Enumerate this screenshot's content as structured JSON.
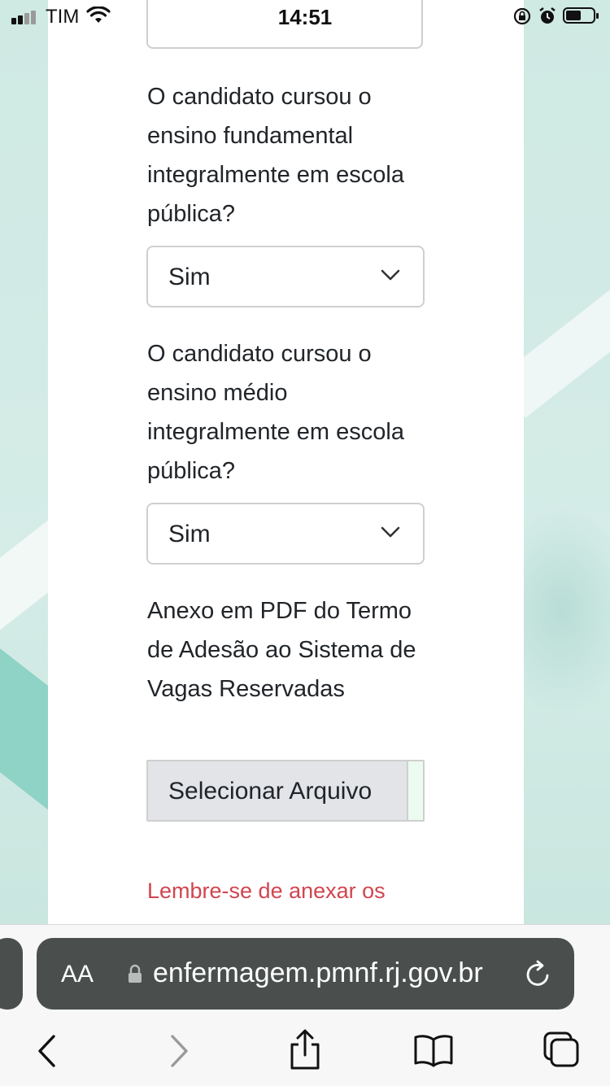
{
  "status_bar": {
    "carrier": "TIM",
    "time": "14:51"
  },
  "form": {
    "question_fundamental": "O candidato cursou o ensino fundamental integralmente em escola pública?",
    "select_fundamental": "Sim",
    "question_medio": "O candidato cursou o ensino médio integralmente em escola pública?",
    "select_medio": "Sim",
    "attachment_label": "Anexo em PDF do Termo de Adesão ao Sistema de Vagas Reservadas",
    "file_button_label": "Selecionar Arquivo",
    "reminder": "Lembre-se de anexar os"
  },
  "browser": {
    "text_size_label": "AA",
    "url": "enfermagem.pmnf.rj.gov.br"
  },
  "colors": {
    "accent_text": "#d1454f",
    "address_bar": "#4a4f4d",
    "background_teal": "#8fd2c6"
  },
  "icons": [
    "signal-icon",
    "wifi-icon",
    "rotation-lock-icon",
    "alarm-icon",
    "battery-icon",
    "chevron-down-icon",
    "lock-icon",
    "reload-icon",
    "back-icon",
    "forward-icon",
    "share-icon",
    "bookmarks-icon",
    "tabs-icon"
  ]
}
